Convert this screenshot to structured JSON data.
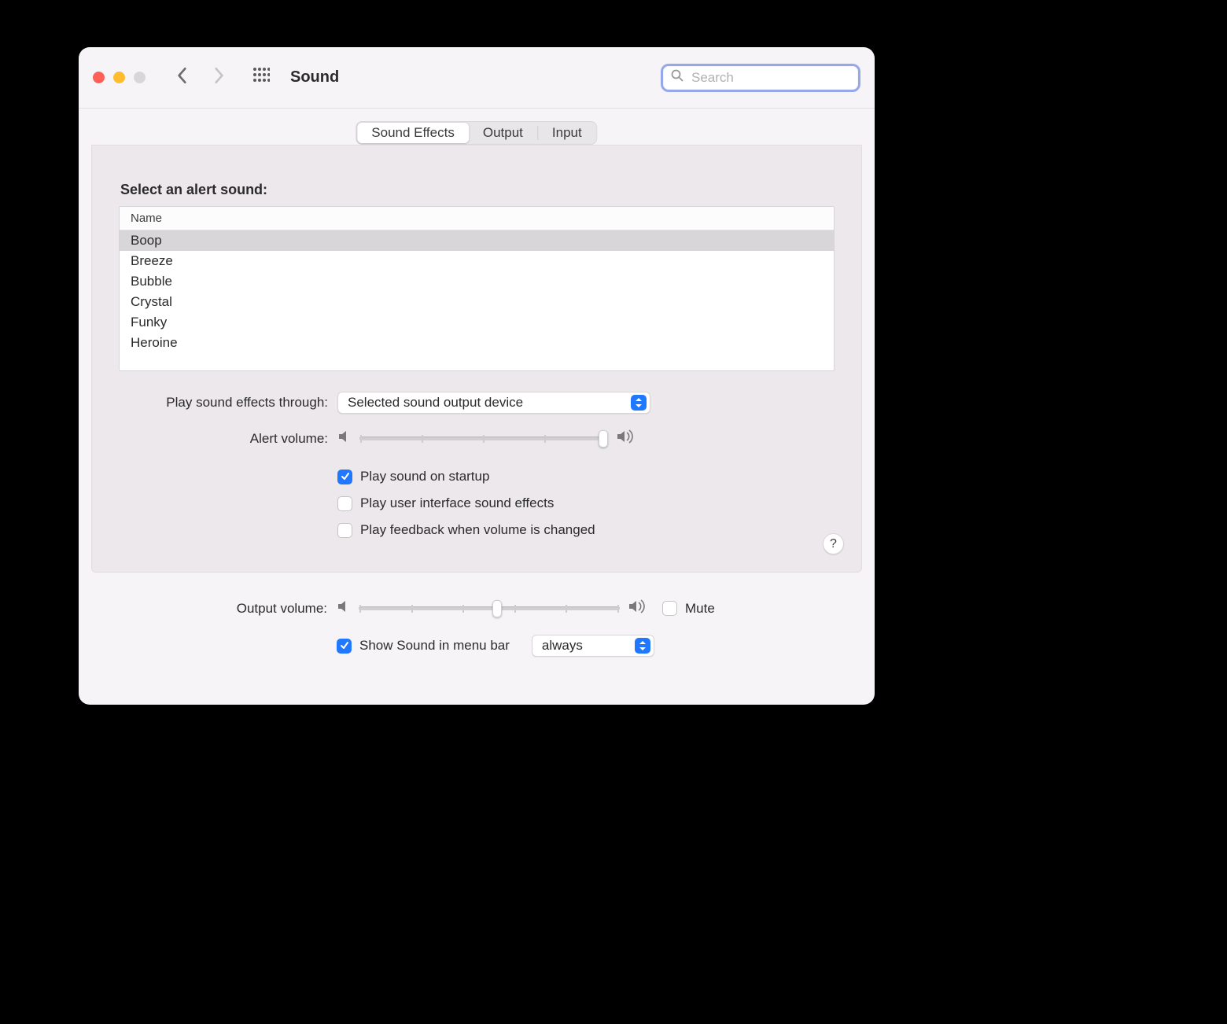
{
  "window": {
    "title": "Sound"
  },
  "search": {
    "placeholder": "Search"
  },
  "tabs": {
    "effects": "Sound Effects",
    "output": "Output",
    "input": "Input"
  },
  "alert": {
    "heading": "Select an alert sound:",
    "column": "Name",
    "sounds": [
      "Boop",
      "Breeze",
      "Bubble",
      "Crystal",
      "Funky",
      "Heroine"
    ],
    "selected_index": 0
  },
  "play_through": {
    "label": "Play sound effects through:",
    "value": "Selected sound output device"
  },
  "alert_volume": {
    "label": "Alert volume:",
    "value_percent": 98
  },
  "checks": {
    "startup": {
      "label": "Play sound on startup",
      "checked": true
    },
    "ui_sounds": {
      "label": "Play user interface sound effects",
      "checked": false
    },
    "feedback": {
      "label": "Play feedback when volume is changed",
      "checked": false
    }
  },
  "output_volume": {
    "label": "Output volume:",
    "value_percent": 53
  },
  "mute": {
    "label": "Mute",
    "checked": false
  },
  "menubar": {
    "label": "Show Sound in menu bar",
    "checked": true,
    "value": "always"
  },
  "help": "?"
}
